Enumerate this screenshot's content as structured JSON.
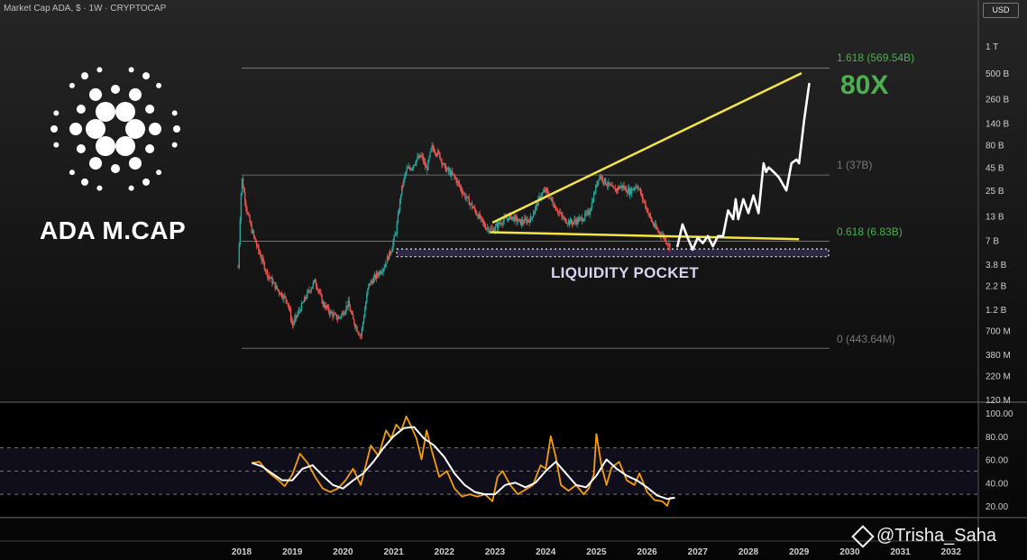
{
  "header": {
    "symbol_title": "Market Cap ADA, $ · 1W · CRYPTOCAP",
    "currency_button": "USD"
  },
  "brand": {
    "title": "ADA M.CAP",
    "logo": "cardano-logo-icon"
  },
  "annotations": {
    "target_multiple": "80X",
    "liquidity_pocket": "LIQUIDITY POCKET",
    "watermark": "@Trisha_Saha",
    "watermark_icon": "binance-square-icon"
  },
  "fib_levels": [
    {
      "label": "1.618 (569.54B)",
      "value_b": 569.54,
      "color": "#4caf50"
    },
    {
      "label": "1 (37B)",
      "value_b": 37,
      "color": "#777777"
    },
    {
      "label": "0.618 (6.83B)",
      "value_b": 6.83,
      "color": "#4caf50"
    },
    {
      "label": "0 (443.64M)",
      "value_b": 0.44364,
      "color": "#777777"
    }
  ],
  "colors": {
    "bull": "#26a69a",
    "bear": "#ef5350",
    "trend": "#f5e642",
    "oscillator": "#f59e0b",
    "signal": "#ffffff",
    "fib_green": "#4caf50"
  },
  "chart_data": [
    {
      "type": "candlestick",
      "title": "Market Cap ADA, $ · 1W · CRYPTOCAP",
      "y_scale": "log",
      "y_unit": "USD",
      "yticks": [
        "1 T",
        "500 B",
        "260 B",
        "140 B",
        "80 B",
        "45 B",
        "25 B",
        "13 B",
        "7 B",
        "3.8 B",
        "2.2 B",
        "1.2 B",
        "700 M",
        "380 M",
        "220 M",
        "120 M"
      ],
      "ytick_values_b": [
        1000,
        500,
        260,
        140,
        80,
        45,
        25,
        13,
        7,
        3.8,
        2.2,
        1.2,
        0.7,
        0.38,
        0.22,
        0.12
      ],
      "xticks": [
        "2018",
        "2019",
        "2020",
        "2021",
        "2022",
        "2023",
        "2024",
        "2025",
        "2026",
        "2027",
        "2028",
        "2029",
        "2030",
        "2031",
        "2032"
      ],
      "close_path": {
        "x": [
          2017.93,
          2018.0,
          2018.1,
          2018.2,
          2018.3,
          2018.5,
          2018.7,
          2018.9,
          2019.0,
          2019.15,
          2019.3,
          2019.45,
          2019.6,
          2019.75,
          2019.9,
          2020.0,
          2020.1,
          2020.2,
          2020.35,
          2020.5,
          2020.65,
          2020.8,
          2020.95,
          2021.05,
          2021.15,
          2021.25,
          2021.35,
          2021.45,
          2021.55,
          2021.65,
          2021.75,
          2021.9,
          2022.0,
          2022.2,
          2022.4,
          2022.6,
          2022.8,
          2022.95,
          2023.1,
          2023.3,
          2023.5,
          2023.7,
          2023.9,
          2024.0,
          2024.2,
          2024.35,
          2024.5,
          2024.7,
          2024.85,
          2024.95,
          2025.05,
          2025.2,
          2025.35,
          2025.5,
          2025.65,
          2025.8,
          2025.95,
          2026.1,
          2026.2,
          2026.3,
          2026.45
        ],
        "y_b": [
          3.5,
          35,
          15,
          9,
          6,
          3,
          2,
          1.5,
          0.8,
          1.2,
          1.8,
          2.5,
          1.4,
          1.1,
          0.95,
          1.1,
          1.4,
          0.9,
          0.6,
          2.2,
          2.8,
          3.5,
          5.5,
          9,
          25,
          42,
          45,
          55,
          60,
          42,
          75,
          62,
          45,
          35,
          22,
          15,
          10,
          9,
          11,
          13,
          11,
          12,
          22,
          25,
          16,
          12,
          11,
          12,
          14,
          22,
          37,
          30,
          25,
          28,
          24,
          29,
          18,
          11,
          9,
          8,
          6
        ]
      },
      "horizontal_levels_b": [
        569.54,
        37,
        6.83,
        0.44364
      ],
      "liquidity_pocket_range_b": [
        4.6,
        5.6
      ],
      "trendlines": [
        {
          "name": "upper",
          "from": [
            2022.95,
            11
          ],
          "to": [
            2029.05,
            500
          ]
        },
        {
          "name": "lower",
          "from": [
            2022.9,
            8.6
          ],
          "to": [
            2029.0,
            7.2
          ]
        }
      ],
      "projection": {
        "x": [
          2026.6,
          2026.7,
          2026.8,
          2026.9,
          2027.0,
          2027.1,
          2027.2,
          2027.3,
          2027.4,
          2027.5,
          2027.6,
          2027.7,
          2027.75,
          2027.8,
          2027.9,
          2028.0,
          2028.1,
          2028.2,
          2028.3,
          2028.35,
          2028.4,
          2028.5,
          2028.6,
          2028.75,
          2028.85,
          2028.95,
          2029.0,
          2029.1,
          2029.2
        ],
        "y_b": [
          6.0,
          10.5,
          7.5,
          5.5,
          7.5,
          6.5,
          7.8,
          6.0,
          7.8,
          7.8,
          15,
          12,
          20,
          12,
          20,
          14,
          22,
          14,
          50,
          40,
          45,
          40,
          35,
          25,
          50,
          55,
          50,
          150,
          380
        ]
      }
    },
    {
      "type": "line",
      "yticks": [
        "100.00",
        "80.00",
        "60.00",
        "40.00",
        "20.00"
      ],
      "ytick_values": [
        100,
        80,
        60,
        40,
        20
      ],
      "bands": [
        30,
        50,
        70
      ],
      "series": [
        {
          "x": [
            2018.2,
            2018.35,
            2018.5,
            2018.7,
            2018.85,
            2019.0,
            2019.15,
            2019.3,
            2019.45,
            2019.6,
            2019.75,
            2019.9,
            2020.05,
            2020.2,
            2020.35,
            2020.55,
            2020.7,
            2020.85,
            2020.95,
            2021.05,
            2021.15,
            2021.25,
            2021.35,
            2021.45,
            2021.55,
            2021.65,
            2021.75,
            2021.9,
            2022.05,
            2022.2,
            2022.35,
            2022.5,
            2022.65,
            2022.8,
            2022.95,
            2023.05,
            2023.15,
            2023.3,
            2023.45,
            2023.6,
            2023.75,
            2023.9,
            2024.0,
            2024.1,
            2024.2,
            2024.3,
            2024.45,
            2024.6,
            2024.75,
            2024.85,
            2024.95,
            2025.0,
            2025.1,
            2025.2,
            2025.3,
            2025.45,
            2025.6,
            2025.75,
            2025.85,
            2026.0,
            2026.15,
            2026.3,
            2026.4,
            2026.45,
            2026.55
          ],
          "values": [
            57,
            58,
            50,
            43,
            37,
            47,
            65,
            57,
            45,
            35,
            32,
            35,
            42,
            52,
            38,
            72,
            63,
            85,
            78,
            90,
            85,
            97,
            88,
            78,
            60,
            85,
            68,
            45,
            50,
            35,
            28,
            30,
            28,
            30,
            24,
            45,
            50,
            38,
            30,
            34,
            38,
            55,
            52,
            80,
            62,
            38,
            33,
            38,
            30,
            35,
            47,
            82,
            55,
            38,
            53,
            58,
            42,
            38,
            48,
            32,
            25,
            24,
            20,
            27,
            27
          ]
        },
        {
          "x": [
            2018.2,
            2018.4,
            2018.6,
            2018.8,
            2019.0,
            2019.2,
            2019.4,
            2019.6,
            2019.8,
            2020.0,
            2020.2,
            2020.4,
            2020.6,
            2020.8,
            2021.0,
            2021.2,
            2021.4,
            2021.6,
            2021.8,
            2022.0,
            2022.2,
            2022.4,
            2022.6,
            2022.8,
            2023.0,
            2023.2,
            2023.4,
            2023.6,
            2023.8,
            2024.0,
            2024.2,
            2024.4,
            2024.6,
            2024.8,
            2025.0,
            2025.2,
            2025.4,
            2025.6,
            2025.8,
            2026.0,
            2026.2,
            2026.4,
            2026.55
          ],
          "values": [
            57,
            54,
            48,
            42,
            42,
            52,
            55,
            46,
            38,
            35,
            42,
            48,
            58,
            70,
            80,
            87,
            88,
            78,
            72,
            62,
            48,
            38,
            32,
            30,
            30,
            38,
            40,
            36,
            40,
            50,
            58,
            48,
            38,
            36,
            46,
            60,
            52,
            46,
            42,
            36,
            29,
            26,
            27
          ]
        }
      ]
    }
  ]
}
